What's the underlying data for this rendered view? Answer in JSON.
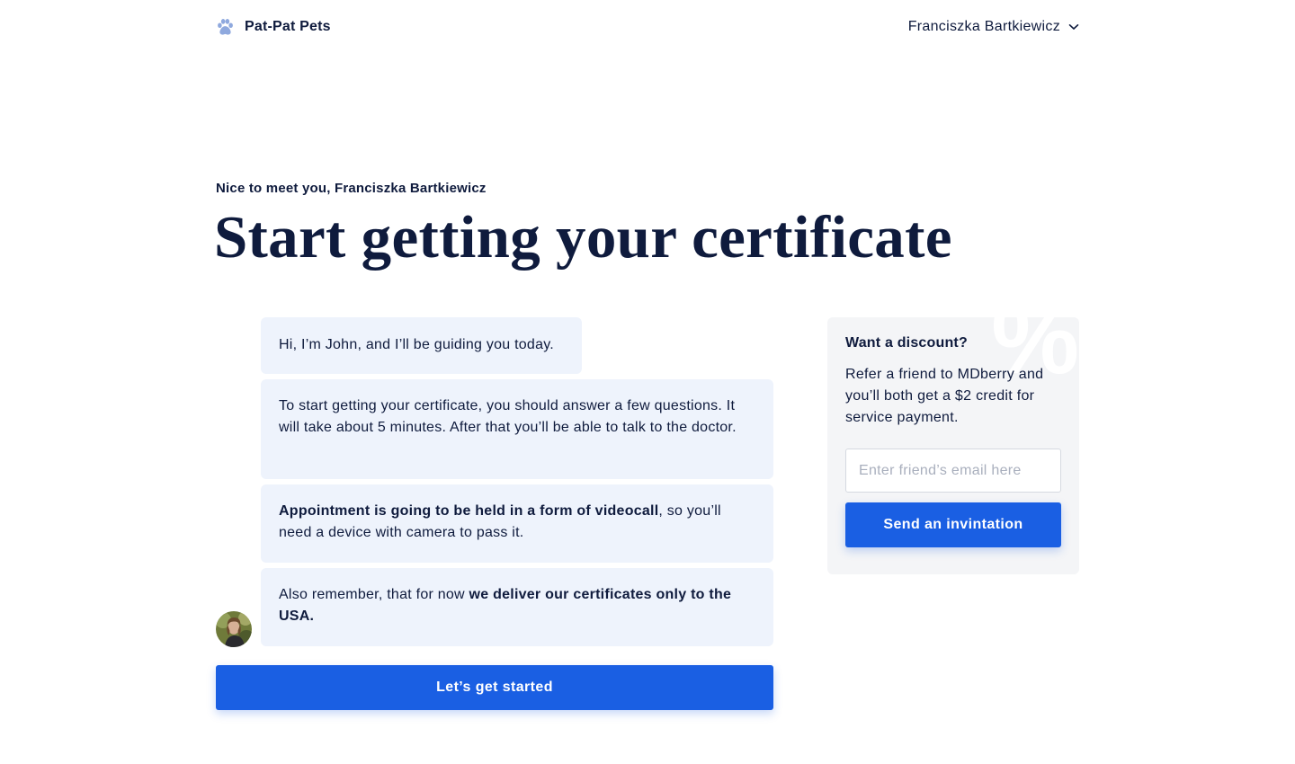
{
  "header": {
    "brand_name": "Pat-Pat Pets",
    "brand_icon": "paw-icon",
    "user_name": "Franciszka Bartkiewicz",
    "user_menu_icon": "chevron-down-icon"
  },
  "intro": {
    "greeting": "Nice to meet you, Franciszka Bartkiewicz",
    "title": "Start getting your certificate"
  },
  "chat": {
    "messages": [
      {
        "parts": [
          {
            "text": "Hi, I’m John, and I’ll be guiding you today.",
            "bold": false
          }
        ]
      },
      {
        "parts": [
          {
            "text": "To start getting your certificate, you should answer a few questions. It will take about 5 minutes. After that you’ll be able to talk to the doctor.",
            "bold": false
          }
        ]
      },
      {
        "parts": [
          {
            "text": "Appointment is going to be held in a form of videocall",
            "bold": true
          },
          {
            "text": ", so you’ll need a device with camera to pass it.",
            "bold": false
          }
        ]
      },
      {
        "parts": [
          {
            "text": "Also remember, that for now ",
            "bold": false
          },
          {
            "text": "we deliver our certificates only to the USA.",
            "bold": true
          }
        ]
      }
    ],
    "cta_label": "Let’s get started"
  },
  "discount": {
    "title": "Want a discount?",
    "text": "Refer a friend to MDberry and you’ll both get a $2 credit for service payment.",
    "decor_symbol": "%",
    "email_placeholder": "Enter friend’s email here",
    "email_value": "",
    "button_label": "Send an invintation"
  },
  "colors": {
    "primary": "#1a5fe3",
    "text": "#0f1b3d",
    "bubble_bg": "#eef3fc",
    "card_bg": "#f4f5f7",
    "paw": "#8fa9de"
  }
}
